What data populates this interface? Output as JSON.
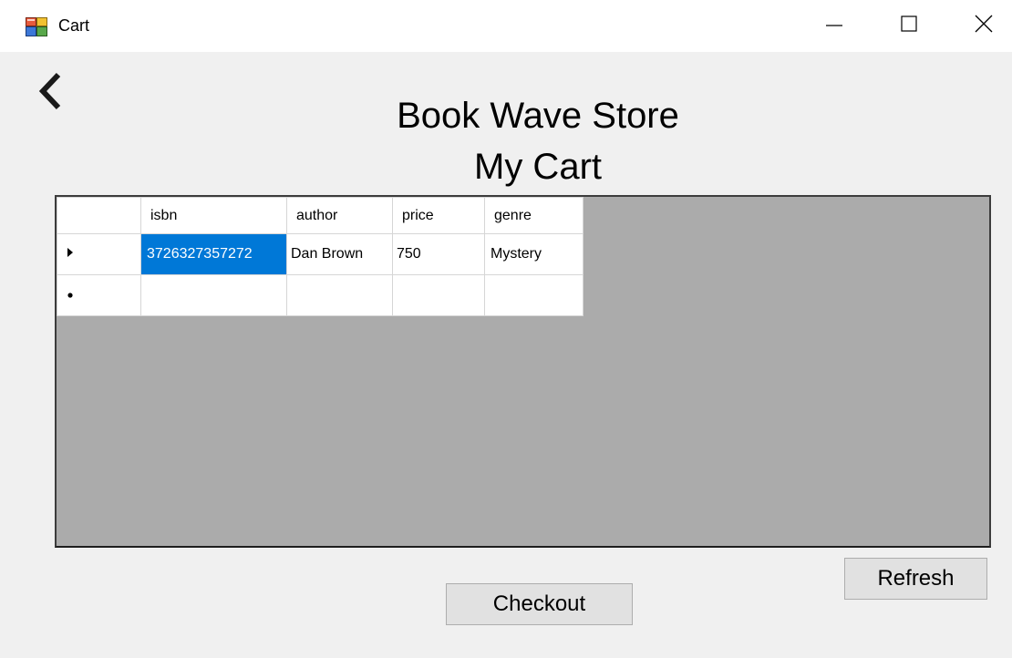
{
  "window": {
    "title": "Cart",
    "icons": {
      "app": "app-window-icon",
      "minimize": "minimize-icon",
      "maximize": "maximize-icon",
      "close": "close-icon",
      "back": "chevron-left-icon"
    }
  },
  "header": {
    "store_name": "Book Wave Store",
    "page_title": "My Cart"
  },
  "cart_table": {
    "columns": [
      "isbn",
      "author",
      "price",
      "genre"
    ],
    "rows": [
      {
        "indicator": "current-row-arrow",
        "isbn": "3726327357272",
        "author": "Dan Brown",
        "price": "750",
        "genre": "Mystery",
        "selected_cell": "isbn"
      }
    ],
    "new_row_indicator": "new-row-asterisk"
  },
  "buttons": {
    "refresh_label": "Refresh",
    "checkout_label": "Checkout"
  },
  "colors": {
    "selection": "#0078d7",
    "grid_background": "#ababab",
    "window_background": "#f0f0f0"
  }
}
